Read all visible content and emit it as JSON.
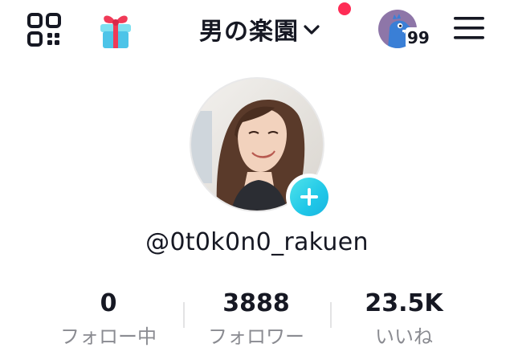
{
  "header": {
    "title": "男の楽園",
    "coin_count": "99",
    "colors": {
      "notification": "#fe2c55",
      "add_accent": "#20c7e8"
    }
  },
  "icons": {
    "qr": "qr-code-icon",
    "gift": "gift-box-icon",
    "title_dropdown": "chevron-down-icon",
    "coin": "dinosaur-avatar-icon",
    "menu": "hamburger-menu-icon",
    "add": "plus-icon"
  },
  "profile": {
    "username": "@0t0k0n0_rakuen"
  },
  "stats": [
    {
      "value": "0",
      "label": "フォロー中"
    },
    {
      "value": "3888",
      "label": "フォロワー"
    },
    {
      "value": "23.5K",
      "label": "いいね"
    }
  ]
}
